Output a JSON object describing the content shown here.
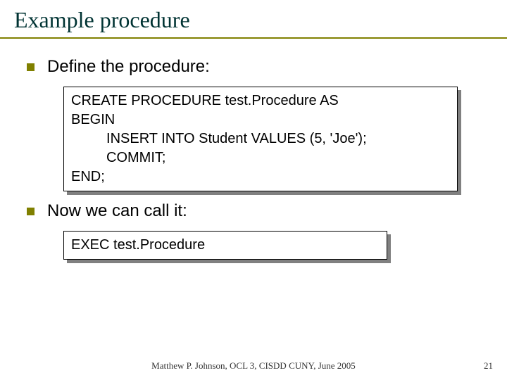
{
  "slide": {
    "title": "Example procedure",
    "bullets": [
      {
        "text": "Define the procedure:"
      },
      {
        "text": "Now we can call it:"
      }
    ],
    "code_blocks": [
      "CREATE PROCEDURE test.Procedure AS\nBEGIN\n         INSERT INTO Student VALUES (5, 'Joe');\n         COMMIT;\nEND;",
      "EXEC test.Procedure"
    ],
    "footer": "Matthew P. Johnson, OCL 3, CISDD CUNY, June 2005",
    "page_number": "21"
  }
}
